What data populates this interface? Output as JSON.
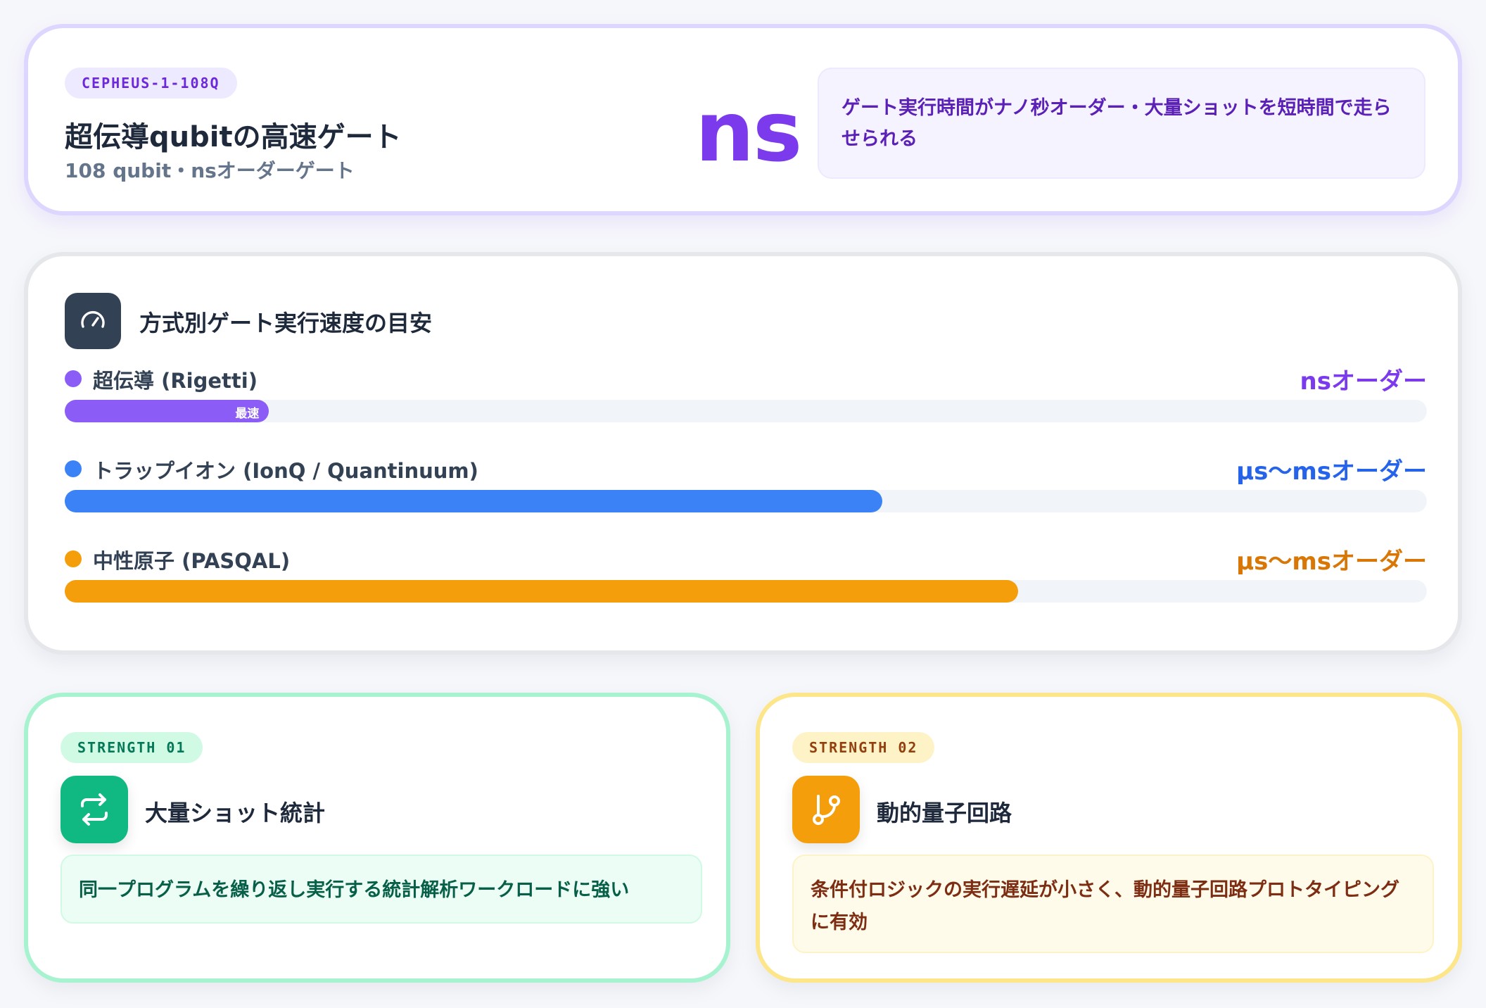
{
  "hero": {
    "tag": "CEPHEUS-1-108Q",
    "title": "超伝導qubitの高速ゲート",
    "subtitle": "108 qubit・nsオーダーゲート",
    "unit": "ns",
    "note": "ゲート実行時間がナノ秒オーダー・大量ショットを短時間で走らせられる",
    "accent": "#7c3aed"
  },
  "speed": {
    "icon": "speedometer-icon",
    "title": "方式別ゲート実行速度の目安",
    "rows": [
      {
        "label": "超伝導 (Rigetti)",
        "value": "nsオーダー",
        "badge": "最速",
        "fill": 0.15,
        "color": "#8b5cf6",
        "value_color": "#7c3aed"
      },
      {
        "label": "トラップイオン (IonQ / Quantinuum)",
        "value": "µs〜msオーダー",
        "badge": "",
        "fill": 0.6,
        "color": "#3b82f6",
        "value_color": "#2563eb"
      },
      {
        "label": "中性原子 (PASQAL)",
        "value": "µs〜msオーダー",
        "badge": "",
        "fill": 0.7,
        "color": "#f59e0b",
        "value_color": "#d97706"
      }
    ]
  },
  "strengths": [
    {
      "tag": "STRENGTH 01",
      "icon": "repeat-arrows-icon",
      "title": "大量ショット統計",
      "desc": "同一プログラムを繰り返し実行する統計解析ワークロードに強い",
      "accent": "#10b981"
    },
    {
      "tag": "STRENGTH 02",
      "icon": "branch-icon",
      "title": "動的量子回路",
      "desc": "条件付ロジックの実行遅延が小さく、動的量子回路プロトタイピングに有効",
      "accent": "#f59e0b"
    }
  ]
}
